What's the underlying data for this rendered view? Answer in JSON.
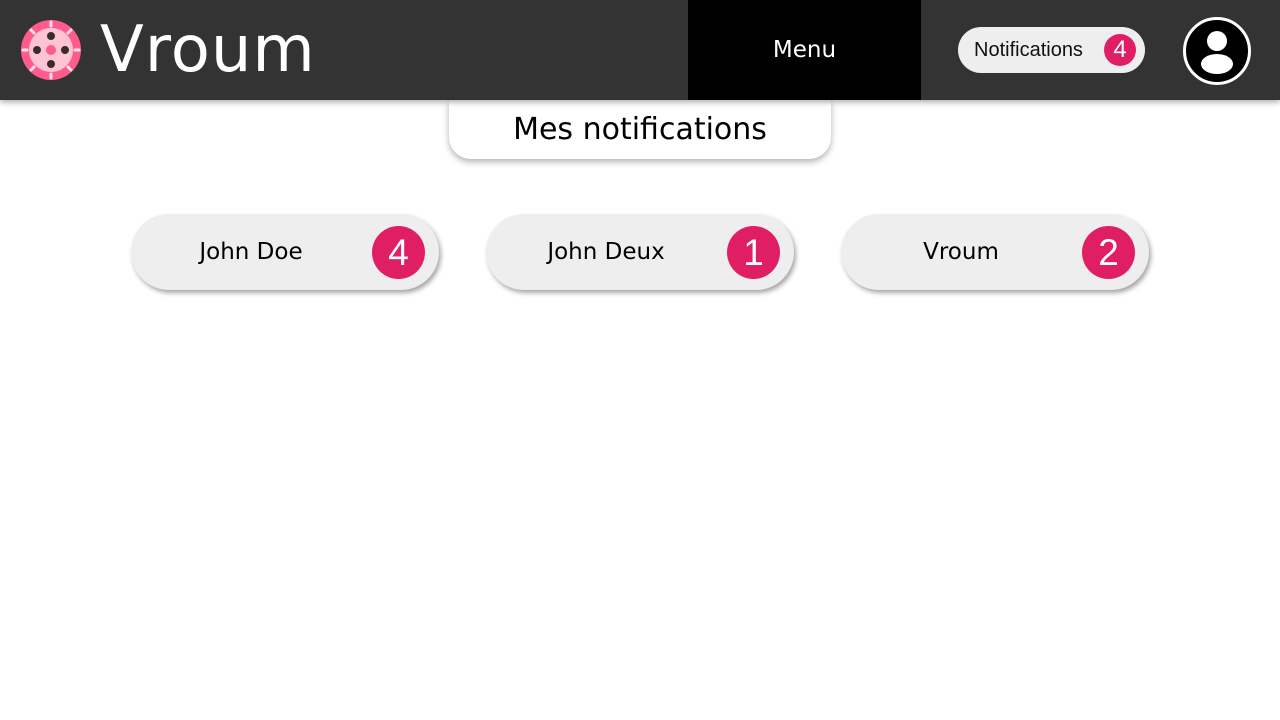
{
  "header": {
    "brand": "Vroum",
    "logo_icon": "steering-wheel-icon",
    "menu_label": "Menu",
    "notifications_label": "Notifications",
    "notifications_count": "4",
    "avatar_icon": "user-icon"
  },
  "page": {
    "title": "Mes notifications"
  },
  "conversations": [
    {
      "name": "John Doe",
      "count": "4"
    },
    {
      "name": "John Deux",
      "count": "1"
    },
    {
      "name": "Vroum",
      "count": "2"
    }
  ],
  "colors": {
    "header_bg": "#333333",
    "menu_bg": "#000000",
    "accent": "#e01e63",
    "pill_bg": "#eeeeee"
  }
}
